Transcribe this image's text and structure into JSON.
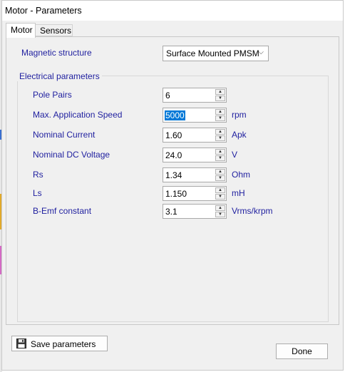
{
  "window": {
    "title": "Motor - Parameters"
  },
  "tabs": [
    {
      "label": "Motor",
      "active": true
    },
    {
      "label": "Sensors",
      "active": false
    }
  ],
  "magnetic_structure": {
    "label": "Magnetic structure",
    "selected": "Surface Mounted PMSM"
  },
  "electrical": {
    "group_title": "Electrical parameters",
    "rows": [
      {
        "label": "Pole Pairs",
        "value": "6",
        "unit": ""
      },
      {
        "label": "Max. Application Speed",
        "value": "5000",
        "unit": "rpm"
      },
      {
        "label": "Nominal Current",
        "value": "1.60",
        "unit": "Apk"
      },
      {
        "label": "Nominal DC Voltage",
        "value": "24.0",
        "unit": "V"
      },
      {
        "label": "Rs",
        "value": "1.34",
        "unit": "Ohm"
      },
      {
        "label": "Ls",
        "value": "1.150",
        "unit": "mH"
      },
      {
        "label": "B-Emf constant",
        "value": "3.1",
        "unit": "Vrms/krpm"
      }
    ]
  },
  "buttons": {
    "save_label": "Save parameters",
    "done_label": "Done"
  },
  "icons": {
    "save": "floppy-disk-icon",
    "dropdown": "chevron-down-icon",
    "spin_up": "arrow-up-icon",
    "spin_down": "arrow-down-icon"
  },
  "colors": {
    "label_blue": "#1f1f9f",
    "selection": "#0078d7",
    "dialog_bg": "#f0f0f0"
  }
}
